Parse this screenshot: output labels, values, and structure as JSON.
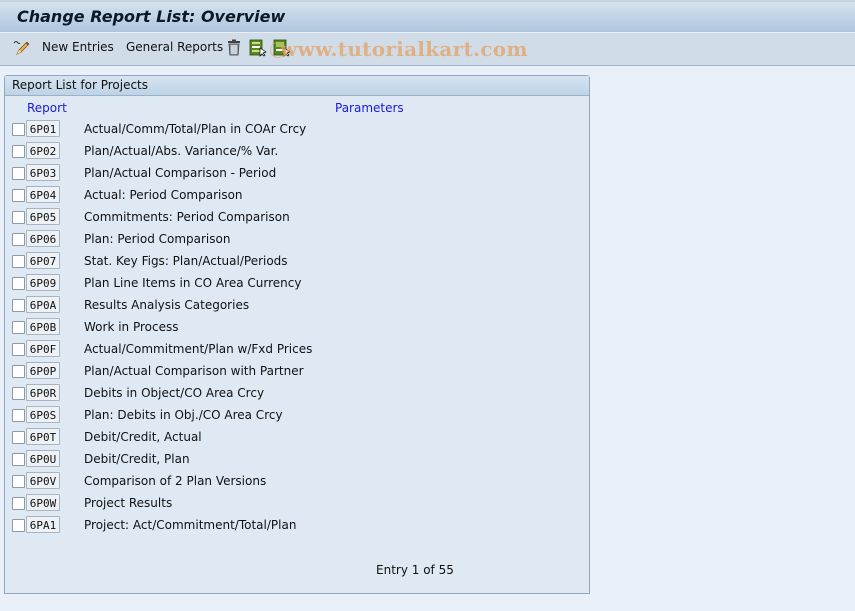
{
  "window": {
    "title": "Change Report List: Overview"
  },
  "toolbar": {
    "items": [
      {
        "icon": "edit-pencil-icon"
      },
      {
        "label": "New Entries"
      },
      {
        "label": "General Reports"
      },
      {
        "icon": "delete-trash-icon"
      },
      {
        "icon": "select-all-icon"
      },
      {
        "icon": "deselect-all-icon"
      }
    ],
    "new_entries": "New Entries",
    "general_reports": "General Reports"
  },
  "watermark": "www.tutorialkart.com",
  "panel": {
    "title": "Report List for Projects",
    "columns": {
      "report": "Report",
      "parameters": "Parameters"
    },
    "rows": [
      {
        "key": "6P01",
        "desc": "Actual/Comm/Total/Plan in COAr Crcy",
        "checked": false
      },
      {
        "key": "6P02",
        "desc": "Plan/Actual/Abs. Variance/% Var.",
        "checked": false
      },
      {
        "key": "6P03",
        "desc": "Plan/Actual Comparison - Period",
        "checked": false
      },
      {
        "key": "6P04",
        "desc": "Actual: Period Comparison",
        "checked": false
      },
      {
        "key": "6P05",
        "desc": "Commitments: Period Comparison",
        "checked": false
      },
      {
        "key": "6P06",
        "desc": "Plan: Period Comparison",
        "checked": false
      },
      {
        "key": "6P07",
        "desc": "Stat. Key Figs: Plan/Actual/Periods",
        "checked": false
      },
      {
        "key": "6P09",
        "desc": "Plan Line Items in CO Area Currency",
        "checked": false
      },
      {
        "key": "6P0A",
        "desc": "Results Analysis Categories",
        "checked": false
      },
      {
        "key": "6P0B",
        "desc": "Work in Process",
        "checked": false
      },
      {
        "key": "6P0F",
        "desc": "Actual/Commitment/Plan w/Fxd Prices",
        "checked": false
      },
      {
        "key": "6P0P",
        "desc": "Plan/Actual Comparison with Partner",
        "checked": false
      },
      {
        "key": "6P0R",
        "desc": "Debits in Object/CO Area Crcy",
        "checked": false
      },
      {
        "key": "6P0S",
        "desc": "Plan: Debits in Obj./CO Area Crcy",
        "checked": false
      },
      {
        "key": "6P0T",
        "desc": "Debit/Credit, Actual",
        "checked": false
      },
      {
        "key": "6P0U",
        "desc": "Debit/Credit, Plan",
        "checked": false
      },
      {
        "key": "6P0V",
        "desc": "Comparison of 2 Plan Versions",
        "checked": false
      },
      {
        "key": "6P0W",
        "desc": "Project Results",
        "checked": false
      },
      {
        "key": "6PA1",
        "desc": "Project: Act/Commitment/Total/Plan",
        "checked": false
      }
    ],
    "entry_info": "Entry 1 of 55"
  }
}
